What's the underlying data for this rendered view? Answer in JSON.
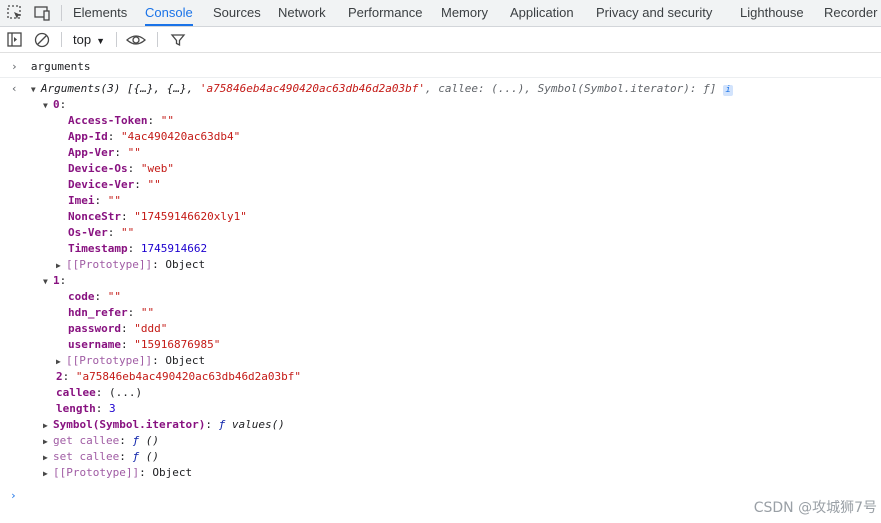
{
  "tabs": [
    "Elements",
    "Console",
    "Sources",
    "Network",
    "Performance",
    "Memory",
    "Application",
    "Privacy and security",
    "Lighthouse",
    "Recorder"
  ],
  "toolbar": {
    "context": "top"
  },
  "console": {
    "input": "arguments",
    "summary_name": "Arguments(3)",
    "summary_preview": " [{…}, {…}, ",
    "summary_str": "'a75846eb4ac490420ac63db46d2a03bf'",
    "summary_rest": ", callee: (...), Symbol(Symbol.iterator): ƒ]",
    "obj0_key": "0",
    "obj0_props": [
      {
        "key": "Access-Token",
        "value": "\"\"",
        "type": "s"
      },
      {
        "key": "App-Id",
        "value": "\"4ac490420ac63db4\"",
        "type": "s"
      },
      {
        "key": "App-Ver",
        "value": "\"\"",
        "type": "s"
      },
      {
        "key": "Device-Os",
        "value": "\"web\"",
        "type": "s"
      },
      {
        "key": "Device-Ver",
        "value": "\"\"",
        "type": "s"
      },
      {
        "key": "Imei",
        "value": "\"\"",
        "type": "s"
      },
      {
        "key": "NonceStr",
        "value": "\"17459146620xly1\"",
        "type": "s"
      },
      {
        "key": "Os-Ver",
        "value": "\"\"",
        "type": "s"
      },
      {
        "key": "Timestamp",
        "value": "1745914662",
        "type": "n"
      }
    ],
    "prototype_label": "[[Prototype]]",
    "prototype_value": "Object",
    "obj1_key": "1",
    "obj1_props": [
      {
        "key": "code",
        "value": "\"\"",
        "type": "s"
      },
      {
        "key": "hdn_refer",
        "value": "\"\"",
        "type": "s"
      },
      {
        "key": "password",
        "value": "\"ddd\"",
        "type": "s"
      },
      {
        "key": "username",
        "value": "\"15916876985\"",
        "type": "s"
      }
    ],
    "item2_key": "2",
    "item2_value": "\"a75846eb4ac490420ac63db46d2a03bf\"",
    "callee_key": "callee",
    "callee_value": "(...)",
    "length_key": "length",
    "length_value": "3",
    "iterator_key": "Symbol(Symbol.iterator)",
    "iterator_value": "values()",
    "get_callee": "get callee",
    "set_callee": "set callee",
    "fn_value": "()",
    "watermark": "CSDN @攻城狮7号"
  }
}
